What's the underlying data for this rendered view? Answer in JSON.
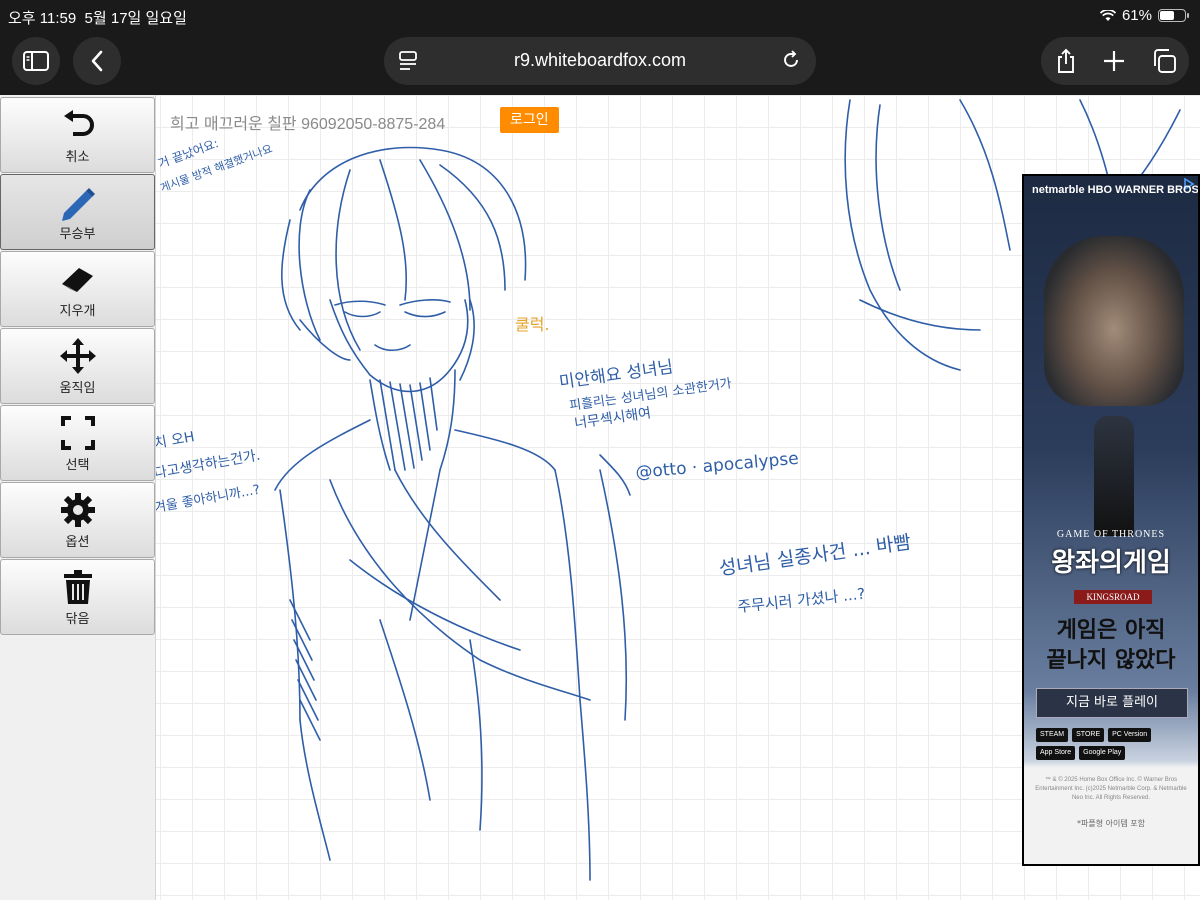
{
  "status_bar": {
    "time": "오후 11:59",
    "date": "5월 17일 일요일",
    "battery": "61%",
    "battery_level": 0.61
  },
  "browser": {
    "url": "r9.whiteboardfox.com",
    "icons": [
      "sidebar-icon",
      "back-icon",
      "reader-icon",
      "reload-icon",
      "share-icon",
      "plus-icon",
      "tabs-icon"
    ]
  },
  "toolbar": {
    "items": [
      {
        "label": "취소",
        "icon": "undo-icon"
      },
      {
        "label": "무승부",
        "icon": "pencil-icon"
      },
      {
        "label": "지우개",
        "icon": "eraser-icon"
      },
      {
        "label": "움직임",
        "icon": "move-icon"
      },
      {
        "label": "선택",
        "icon": "select-icon"
      },
      {
        "label": "옵션",
        "icon": "gear-icon"
      },
      {
        "label": "닦음",
        "icon": "trash-icon"
      }
    ]
  },
  "board": {
    "title": "희고 매끄러운 칠판 96092050-8875-284",
    "login_label": "로그인",
    "notes": {
      "orange": "쿨럭.",
      "apology_1": "미안해요 성녀님",
      "apology_2": "피흘리는 성녀님의 소관한거가",
      "apology_3": "너무섹시해여",
      "handle": "@otto · apocalypse",
      "incident_1": "성녀님 실종사건 ... 바빰",
      "incident_2": "주무시러 가셨나 ...?",
      "left_1": "치 오H",
      "left_2": "다고생각하는건가.",
      "left_3": "겨울 좋아하니까...?",
      "top_1": "거 끝났어요:",
      "top_2": "게시물 방적 해결했거나요"
    }
  },
  "ad": {
    "brands": "netmarble HBO WARNER BROS",
    "game_series": "GAME OF THRONES",
    "game_title": "왕좌의게임",
    "subtitle": "KINGSROAD",
    "headline_1": "게임은 아직",
    "headline_2": "끝나지 않았다",
    "cta": "지금 바로 플레이",
    "stores": [
      "STEAM",
      "STORE",
      "PC Version",
      "App Store",
      "Google Play"
    ],
    "legal": "™ & © 2025 Home Box Office Inc. © Warner Bros Entertainment Inc. (c)2025 Netmarble Corp. & Netmarble Neo Inc. All Rights Reserved.",
    "note": "*파플형 아이템 포함"
  }
}
